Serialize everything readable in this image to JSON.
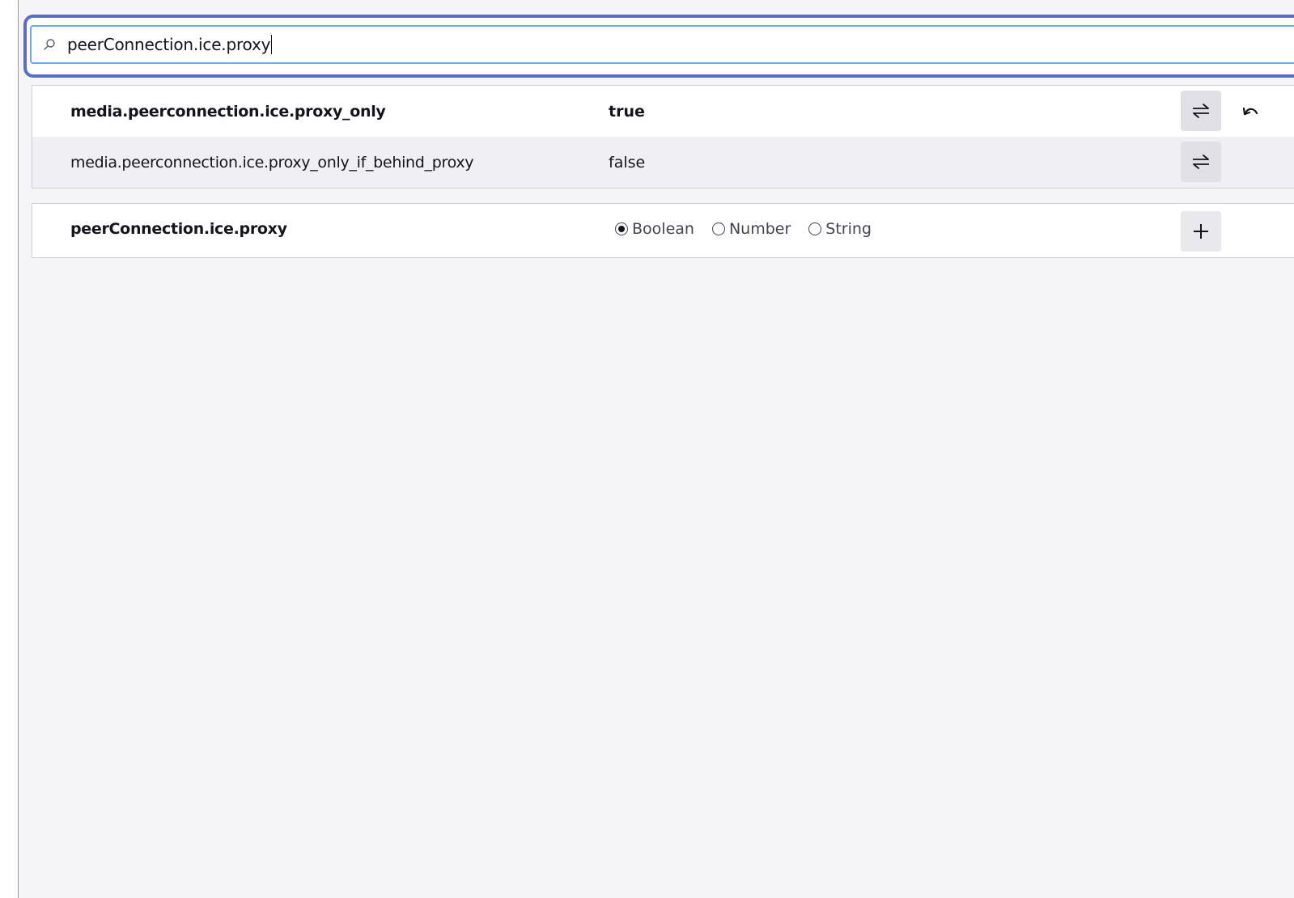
{
  "search": {
    "value": "peerConnection.ice.proxy",
    "icon": "search-icon"
  },
  "preferences": [
    {
      "name": "media.peerconnection.ice.proxy_only",
      "value": "true",
      "modified": true,
      "toggle_icon": "toggle-icon",
      "reset_icon": "reset-icon"
    },
    {
      "name": "media.peerconnection.ice.proxy_only_if_behind_proxy",
      "value": "false",
      "modified": false,
      "toggle_icon": "toggle-icon"
    }
  ],
  "new_preference": {
    "name": "peerConnection.ice.proxy",
    "types": [
      {
        "label": "Boolean",
        "selected": true
      },
      {
        "label": "Number",
        "selected": false
      },
      {
        "label": "String",
        "selected": false
      }
    ],
    "add_icon": "plus-icon"
  },
  "colors": {
    "focus_ring": "#5b6ec7",
    "input_border": "#69a8ff",
    "page_background": "#f5f5f8",
    "alt_row": "#f0f0f4",
    "button_bg": "#e0e0e6"
  }
}
